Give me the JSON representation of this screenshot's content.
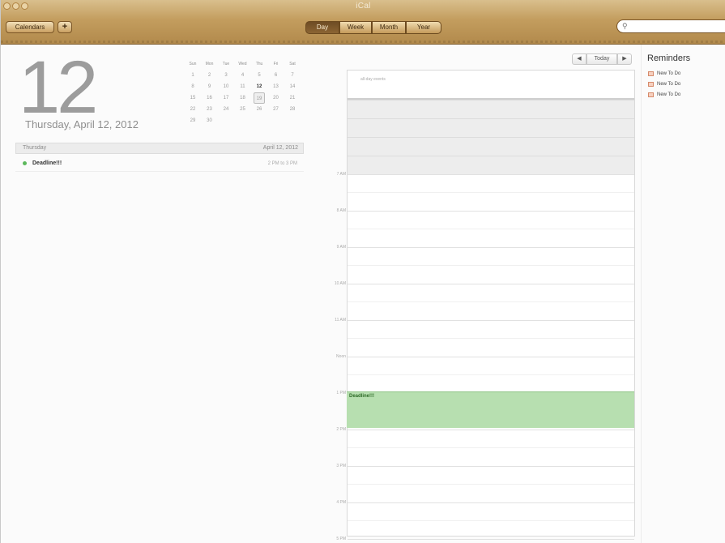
{
  "window": {
    "title": "iCal"
  },
  "toolbar": {
    "calendars_label": "Calendars",
    "add_label": "+",
    "views": [
      {
        "label": "Day",
        "active": true
      },
      {
        "label": "Week",
        "active": false
      },
      {
        "label": "Month",
        "active": false
      },
      {
        "label": "Year",
        "active": false
      }
    ],
    "search_placeholder": ""
  },
  "day_header": {
    "day_number": "12",
    "long_date": "Thursday, April 12, 2012"
  },
  "mini_calendar": {
    "weekdays": [
      "Sun",
      "Mon",
      "Tue",
      "Wed",
      "Thu",
      "Fri",
      "Sat"
    ],
    "weeks": [
      [
        "1",
        "2",
        "3",
        "4",
        "5",
        "6",
        "7"
      ],
      [
        "8",
        "9",
        "10",
        "11",
        "12",
        "13",
        "14"
      ],
      [
        "15",
        "16",
        "17",
        "18",
        "19",
        "20",
        "21"
      ],
      [
        "22",
        "23",
        "24",
        "25",
        "26",
        "27",
        "28"
      ],
      [
        "29",
        "30",
        "",
        "",
        "",
        "",
        ""
      ]
    ],
    "today": "12",
    "selected": "19"
  },
  "event_list": {
    "day_label": "Thursday",
    "date_label": "April 12, 2012",
    "events": [
      {
        "name": "Deadline!!!",
        "time": "2 PM to 3 PM"
      }
    ]
  },
  "day_view": {
    "nav_prev": "◀",
    "nav_today": "Today",
    "nav_next": "▶",
    "all_day_label": "all-day events",
    "hours": [
      "7 AM",
      "8 AM",
      "9 AM",
      "10 AM",
      "11 AM",
      "Noon",
      "1 PM",
      "2 PM",
      "3 PM",
      "4 PM",
      "5 PM"
    ],
    "event_title": "Deadline!!!"
  },
  "reminders": {
    "title": "Reminders",
    "items": [
      "New To Do",
      "New To Do",
      "New To Do"
    ]
  },
  "colors": {
    "toolbar": "#c39d5e",
    "event_green": "#b7dfb0",
    "reminder_box": "#f6d0c0"
  }
}
